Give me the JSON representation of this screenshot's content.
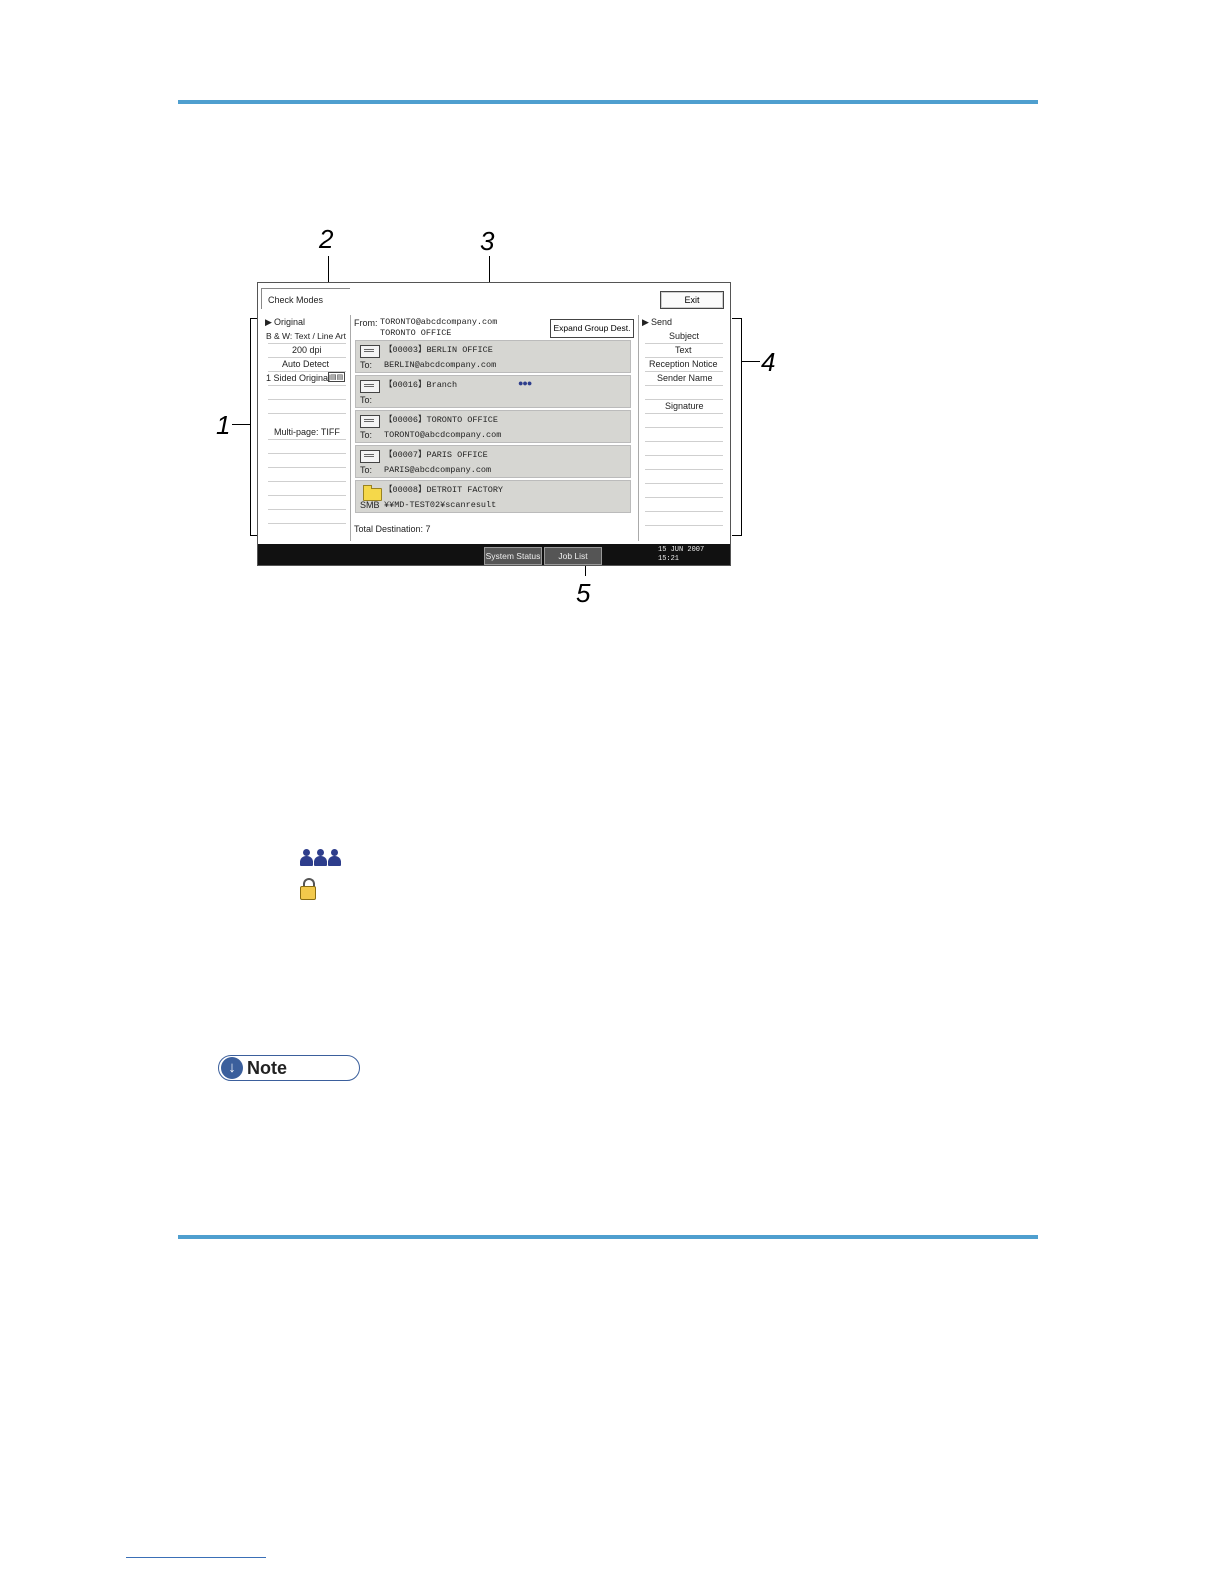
{
  "callouts": {
    "c1": "1",
    "c2": "2",
    "c3": "3",
    "c4": "4",
    "c5": "5"
  },
  "screen": {
    "title": "Check Modes",
    "exit_label": "Exit",
    "left": {
      "header": "Original",
      "items": [
        "B & W: Text / Line Art",
        "200 dpi",
        "Auto Detect",
        "1 Sided Original",
        "",
        "",
        "Multi-page: TIFF"
      ]
    },
    "from": {
      "label": "From:",
      "email": "TORONTO@abcdcompany.com",
      "name": "TORONTO OFFICE"
    },
    "expand_label": "Expand Group Dest.",
    "destinations": [
      {
        "icon": "mail-icon",
        "title": "【00003】BERLIN OFFICE",
        "prefix": "To:",
        "address": "BERLIN@abcdcompany.com",
        "group": false
      },
      {
        "icon": "mail-icon",
        "title": "【00016】Branch",
        "prefix": "To:",
        "address": "",
        "group": true
      },
      {
        "icon": "mail-icon",
        "title": "【00006】TORONTO OFFICE",
        "prefix": "To:",
        "address": "TORONTO@abcdcompany.com",
        "group": false
      },
      {
        "icon": "mail-icon",
        "title": "【00007】PARIS OFFICE",
        "prefix": "To:",
        "address": "PARIS@abcdcompany.com",
        "group": false
      },
      {
        "icon": "folder-icon",
        "title": "【00008】DETROIT FACTORY",
        "prefix": "SMB",
        "address": "¥¥MD-TEST02¥scanresult",
        "group": false
      }
    ],
    "total_label": "Total Destination: 7",
    "right": {
      "header": "Send",
      "items": [
        "Subject",
        "Text",
        "Reception Notice",
        "Sender Name",
        "",
        "Signature"
      ]
    },
    "status_bar": {
      "system_status": "System Status",
      "job_list": "Job List",
      "date": "15 JUN  2007",
      "time": "15:21"
    }
  },
  "note": {
    "label": "Note"
  },
  "icons": {
    "group": "group-people-icon",
    "lock": "lock-icon"
  }
}
